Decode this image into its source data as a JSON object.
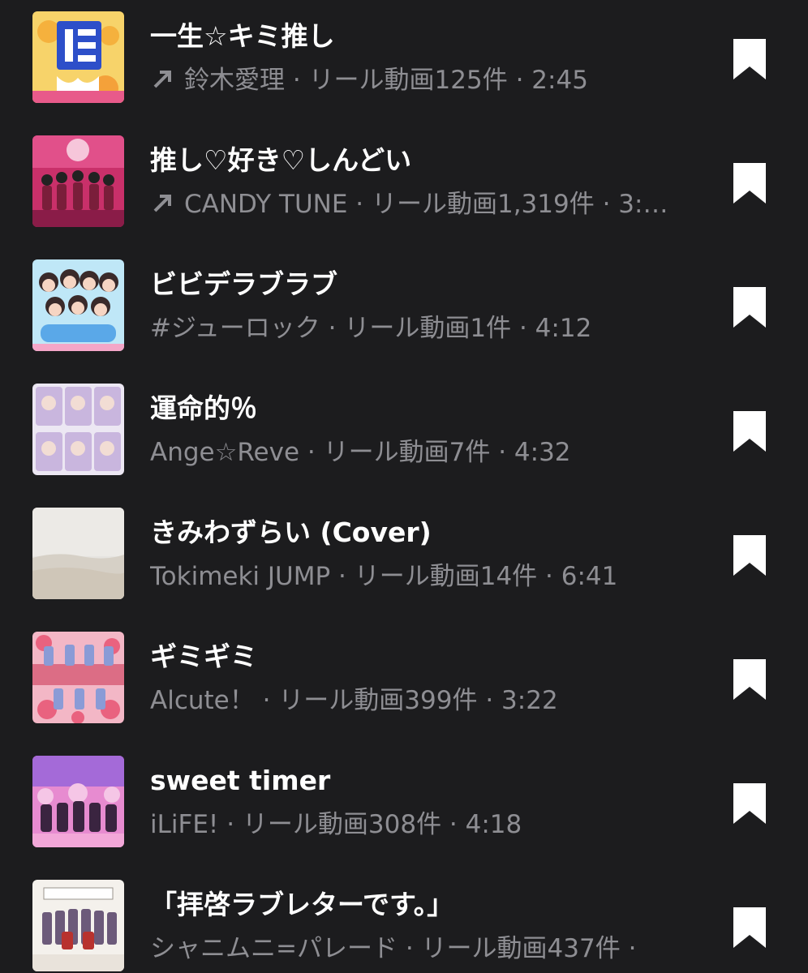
{
  "tracks": [
    {
      "title": "一生☆キミ推し",
      "trending": true,
      "artist": "鈴木愛理",
      "reels": "リール動画125件",
      "duration": "2:45",
      "thumb": "thumb-oshi"
    },
    {
      "title": "推し♡好き♡しんどい",
      "trending": true,
      "artist": "CANDY TUNE",
      "reels": "リール動画1,319件",
      "duration": "3:…",
      "thumb": "thumb-candy-tune"
    },
    {
      "title": "ビビデラブラブ",
      "trending": false,
      "artist": "#ジューロック",
      "reels": "リール動画1件",
      "duration": "4:12",
      "thumb": "thumb-jurock"
    },
    {
      "title": "運命的％",
      "trending": false,
      "artist": "Ange☆Reve",
      "reels": "リール動画7件",
      "duration": "4:32",
      "thumb": "thumb-ange-reve"
    },
    {
      "title": "きみわずらい (Cover)",
      "trending": false,
      "artist": "Tokimeki JUMP",
      "reels": "リール動画14件",
      "duration": "6:41",
      "thumb": "thumb-beach"
    },
    {
      "title": "ギミギミ",
      "trending": false,
      "artist": "Alcute！",
      "reels": "リール動画399件",
      "duration": "3:22",
      "thumb": "thumb-gimigimi"
    },
    {
      "title": "sweet timer",
      "trending": false,
      "artist": "iLiFE!",
      "reels": "リール動画308件",
      "duration": "4:18",
      "thumb": "thumb-ilife"
    },
    {
      "title": "「拝啓ラブレターです。」",
      "trending": false,
      "artist": "シャニムニ=パレード",
      "reels": "リール動画437件",
      "duration": "",
      "thumb": "thumb-love-letter"
    }
  ],
  "separator": " · ",
  "icons": {
    "trending": "trending-arrow-icon",
    "save": "bookmark-icon"
  },
  "colors": {
    "background": "#1c1c1e",
    "title": "#ffffff",
    "subtitle": "#8e8e93",
    "icon": "#ffffff"
  }
}
